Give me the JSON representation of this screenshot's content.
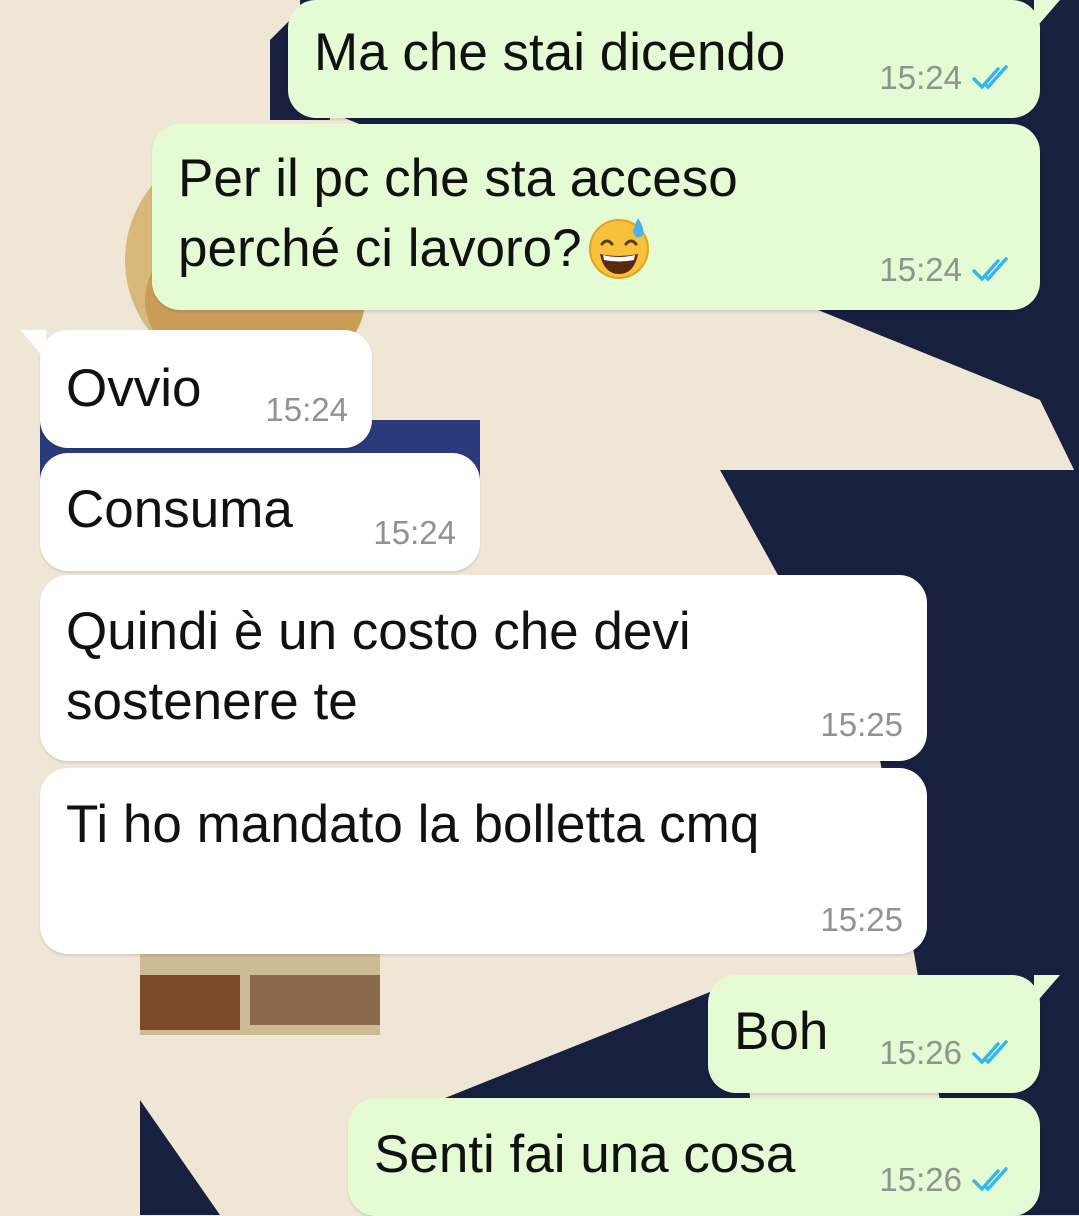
{
  "chat": {
    "messages": [
      {
        "direction": "outgoing",
        "text": "Ma che stai dicendo",
        "time": "15:24",
        "status": "read-double-check-icon"
      },
      {
        "direction": "outgoing",
        "text": "Per il pc che sta acceso\nperché ci lavoro?",
        "emoji": "sweat-smile-emoji",
        "time": "15:24",
        "status": "read-double-check-icon"
      },
      {
        "direction": "incoming",
        "text": "Ovvio",
        "time": "15:24"
      },
      {
        "direction": "incoming",
        "text": "Consuma",
        "time": "15:24"
      },
      {
        "direction": "incoming",
        "text": "Quindi è un costo che devi\nsostenere te",
        "time": "15:25"
      },
      {
        "direction": "incoming",
        "text": "Ti ho mandato la bolletta cmq",
        "time": "15:25"
      },
      {
        "direction": "outgoing",
        "text": "Boh",
        "time": "15:26",
        "status": "read-double-check-icon"
      },
      {
        "direction": "outgoing",
        "text": "Senti fai una cosa",
        "time": "15:26",
        "status": "read-double-check-icon"
      }
    ]
  },
  "colors": {
    "outgoing_bubble": "#e4fbd4",
    "incoming_bubble": "#ffffff",
    "read_ticks": "#34b7f1",
    "wallpaper_cream": "#efe6d6",
    "wallpaper_navy": "#17203f"
  }
}
